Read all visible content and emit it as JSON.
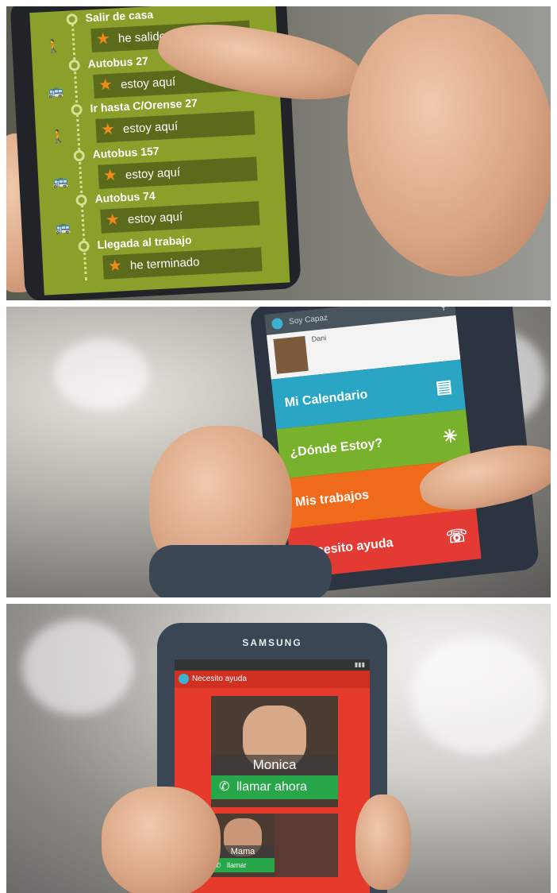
{
  "panel1": {
    "steps": [
      {
        "title": "Salir de casa",
        "status": "he salido"
      },
      {
        "title": "Autobus 27",
        "status": "estoy aquí"
      },
      {
        "title": "Ir hasta C/Orense 27",
        "status": "estoy aquí"
      },
      {
        "title": "Autobus 157",
        "status": "estoy aquí"
      },
      {
        "title": "Autobus 74",
        "status": "estoy aquí"
      },
      {
        "title": "Llegada al trabajo",
        "status": "he terminado"
      }
    ]
  },
  "panel2": {
    "app_title": "Soy Capaz",
    "profile_name": "Dani",
    "menu": [
      {
        "label": "Mi Calendario",
        "color": "#2aa6c4"
      },
      {
        "label": "¿Dónde Estoy?",
        "color": "#78b12b"
      },
      {
        "label": "Mis trabajos",
        "color": "#f06a1c"
      },
      {
        "label": "Necesito ayuda",
        "color": "#e33a34"
      }
    ]
  },
  "panel3": {
    "brand": "SAMSUNG",
    "app_title": "Necesito ayuda",
    "contacts": [
      {
        "name": "Monica",
        "call": "llamar ahora"
      },
      {
        "name": "Mama",
        "call": "llamar"
      }
    ]
  }
}
